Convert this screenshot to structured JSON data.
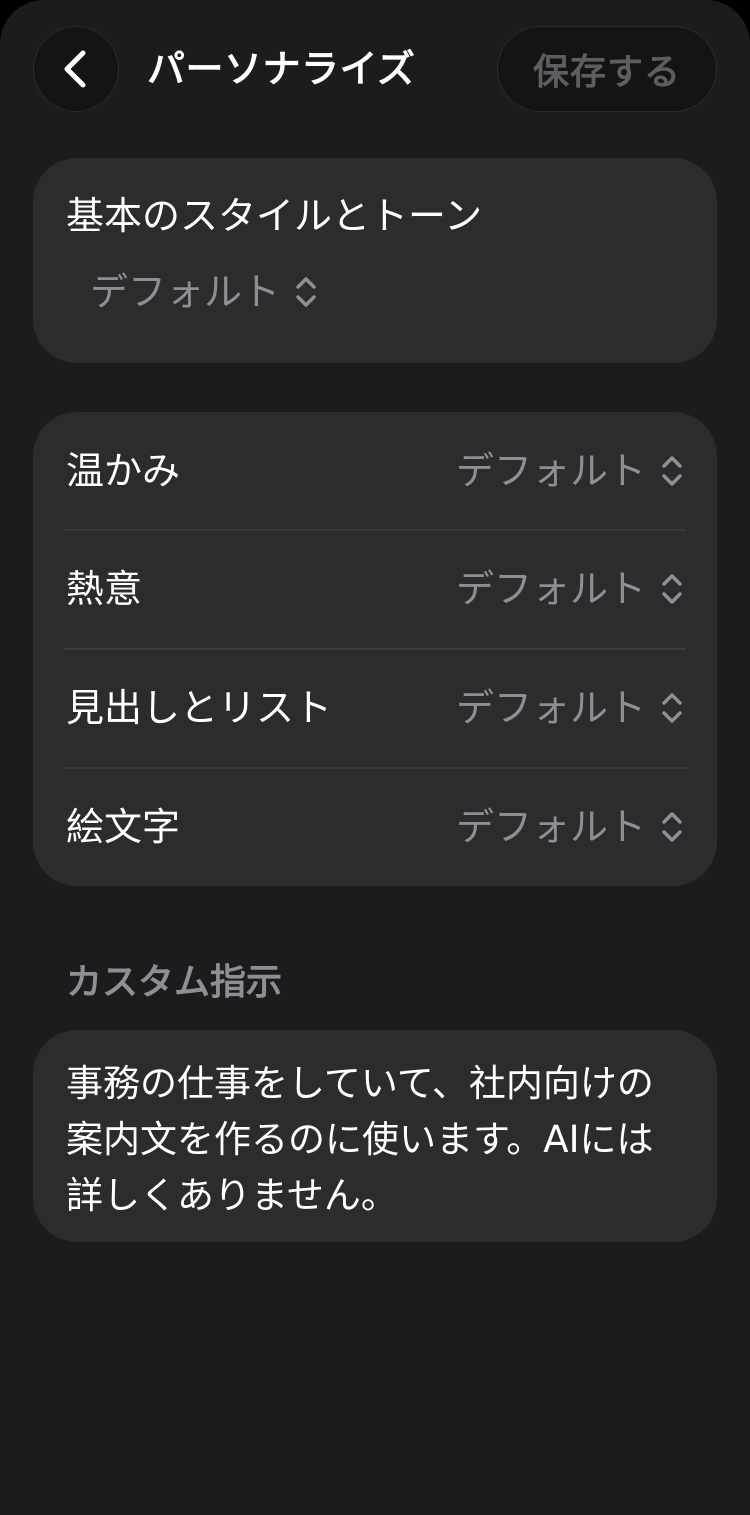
{
  "header": {
    "title": "パーソナライズ",
    "save_label": "保存する"
  },
  "icons": {
    "back": "chevron-left-icon",
    "selector": "chevron-up-down-icon"
  },
  "base_style": {
    "label": "基本のスタイルとトーン",
    "value": "デフォルト"
  },
  "settings": [
    {
      "label": "温かみ",
      "value": "デフォルト"
    },
    {
      "label": "熱意",
      "value": "デフォルト"
    },
    {
      "label": "見出しとリスト",
      "value": "デフォルト"
    },
    {
      "label": "絵文字",
      "value": "デフォルト"
    }
  ],
  "custom_instructions": {
    "title": "カスタム指示",
    "text": "事務の仕事をしていて、社内向けの案内文を作るのに使います。AIには詳しくありません。"
  },
  "colors": {
    "background": "#1c1c1e",
    "card": "#2c2c2e",
    "secondary_text": "#8e8e93",
    "disabled_text": "#5e5e62"
  }
}
